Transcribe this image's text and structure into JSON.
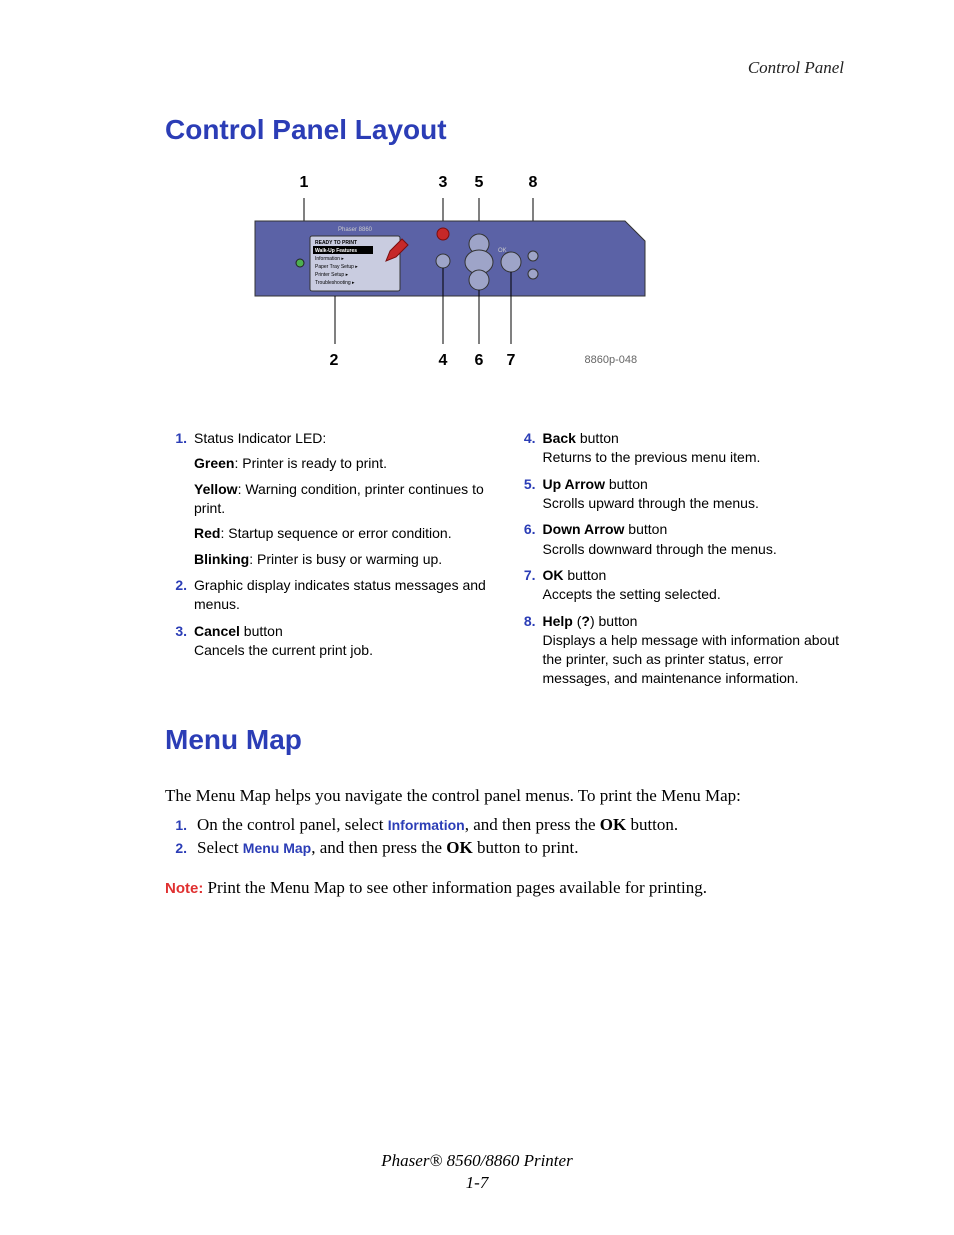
{
  "header": {
    "running": "Control Panel"
  },
  "sections": {
    "control_panel_layout": {
      "title": "Control Panel Layout",
      "diagram": {
        "top_labels": {
          "n1": "1",
          "n3": "3",
          "n5": "5",
          "n8": "8"
        },
        "bottom_labels": {
          "n2": "2",
          "n4": "4",
          "n6": "6",
          "n7": "7"
        },
        "panel_model": "Phaser 8860",
        "screen_lines": {
          "ready": "READY TO PRINT",
          "walkup": "Walk-Up Features",
          "info": "Information",
          "tray": "Paper Tray Setup",
          "printer": "Printer Setup",
          "trouble": "Troubleshooting"
        },
        "ok_label": "OK",
        "fig_ref": "8860p-048"
      },
      "items": {
        "i1": {
          "title": "Status Indicator LED:",
          "green_label": "Green",
          "green_text": ": Printer is ready to print.",
          "yellow_label": "Yellow",
          "yellow_text": ": Warning condition, printer continues to print.",
          "red_label": "Red",
          "red_text": ": Startup sequence or error condition.",
          "blink_label": "Blinking",
          "blink_text": ": Printer is busy or warming up."
        },
        "i2": {
          "text": "Graphic display indicates status messages and menus."
        },
        "i3": {
          "label": "Cancel",
          "suffix": " button",
          "desc": "Cancels the current print job."
        },
        "i4": {
          "label": "Back",
          "suffix": " button",
          "desc": "Returns to the previous menu item."
        },
        "i5": {
          "label": "Up Arrow",
          "suffix": " button",
          "desc": "Scrolls upward through the menus."
        },
        "i6": {
          "label": "Down Arrow",
          "suffix": " button",
          "desc": "Scrolls downward through the menus."
        },
        "i7": {
          "label": "OK",
          "suffix": " button",
          "desc": "Accepts the setting selected."
        },
        "i8": {
          "label": "Help",
          "middle": " (",
          "q": "?",
          "suffix": ") button",
          "desc": "Displays a help message with information about the printer, such as printer status, error messages, and maintenance information."
        }
      },
      "nums": {
        "n1": "1.",
        "n2": "2.",
        "n3": "3.",
        "n4": "4.",
        "n5": "5.",
        "n6": "6.",
        "n7": "7.",
        "n8": "8."
      }
    },
    "menu_map": {
      "title": "Menu Map",
      "intro": "The Menu Map helps you navigate the control panel menus. To print the Menu Map:",
      "step1_pre": "On the control panel, select ",
      "step1_link": "Information",
      "step1_post": ", and then press the ",
      "ok_word": "OK",
      "step1_end": " button.",
      "step2_pre": "Select ",
      "step2_link": "Menu Map",
      "step2_post": ", and then press the ",
      "step2_end": " button to print.",
      "note_label": "Note: ",
      "note_text": "Print the Menu Map to see other information pages available for printing.",
      "nums": {
        "n1": "1.",
        "n2": "2."
      }
    }
  },
  "footer": {
    "product": "Phaser® 8560/8860 Printer",
    "page": "1-7"
  }
}
